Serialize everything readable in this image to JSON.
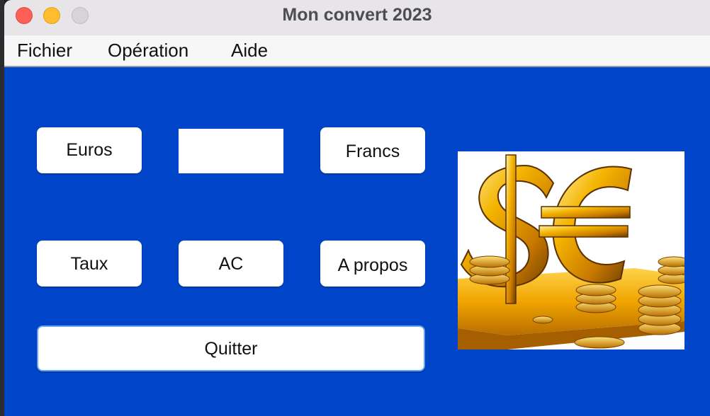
{
  "window": {
    "title": "Mon convert 2023"
  },
  "menu": {
    "items": [
      {
        "label": "Fichier"
      },
      {
        "label": "Opération"
      },
      {
        "label": "Aide"
      }
    ]
  },
  "buttons": {
    "euros": "Euros",
    "francs": "Francs",
    "taux": "Taux",
    "ac": "AC",
    "apropos": "A propos",
    "quitter": "Quitter"
  },
  "input": {
    "value": ""
  },
  "colors": {
    "background": "#0045c9",
    "button": "#ffffff",
    "focus_border": "#5fa5f2"
  },
  "image": {
    "icon": "currency-dollar-euro-gold-image"
  }
}
